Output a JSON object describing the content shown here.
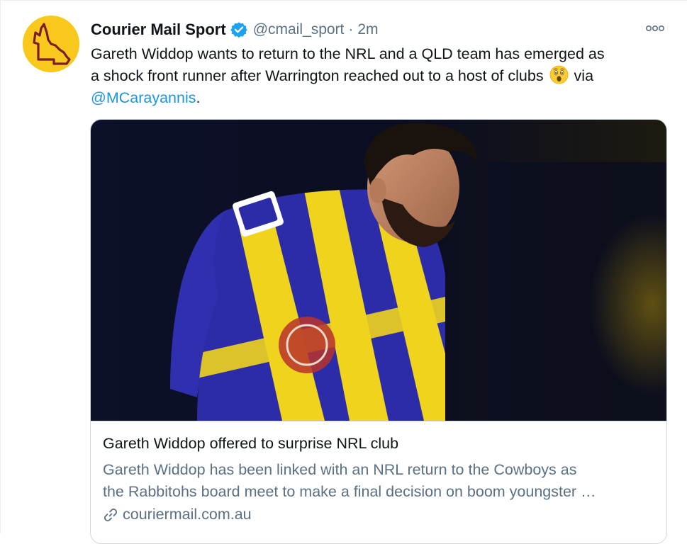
{
  "tweet": {
    "display_name": "Courier Mail Sport",
    "handle": "@cmail_sport",
    "separator": "·",
    "time": "2m",
    "text_line1": "Gareth Widdop wants to return to the NRL and a QLD team has emerged as",
    "text_line2": "a shock front runner after Warrington reached out to a host of clubs",
    "text_via": "via",
    "mention": "@MCarayannis",
    "text_end": ".",
    "emoji": "astonished-face-emoji",
    "icons": {
      "avatar": "queensland-map-logo",
      "verified": "verified-badge-icon",
      "more": "more-options-icon",
      "link": "link-icon"
    },
    "colors": {
      "accent": "#1b95e0",
      "verified": "#1da1f2",
      "avatar_bg": "#f8c81c",
      "avatar_outline": "#7a1d2e",
      "secondary_text": "#5b7083"
    }
  },
  "card": {
    "title": "Gareth Widdop offered to surprise NRL club",
    "description_line1": "Gareth Widdop has been linked with an NRL return to the Cowboys as",
    "description_line2": "the Rabbitohs board meet to make a final decision on boom youngster …",
    "domain": "couriermail.com.au",
    "image": "rugby-player-photo"
  }
}
